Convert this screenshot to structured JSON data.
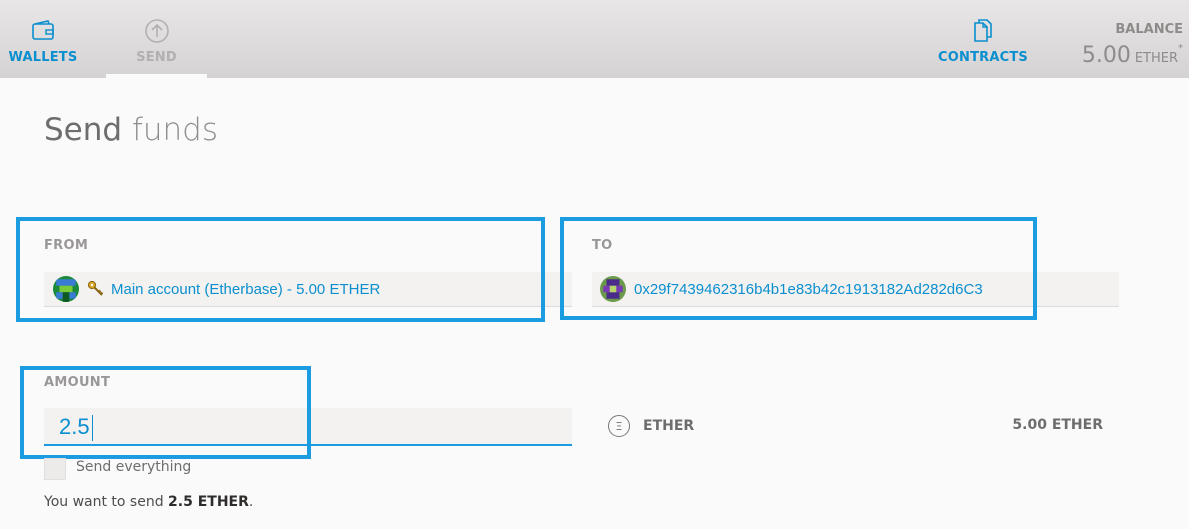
{
  "header": {
    "nav": {
      "wallets": {
        "label": "WALLETS",
        "icon": "wallet-icon"
      },
      "send": {
        "label": "SEND",
        "icon": "arrow-up-circle-icon"
      },
      "contracts": {
        "label": "CONTRACTS",
        "icon": "documents-icon"
      }
    },
    "balance": {
      "label": "BALANCE",
      "value": "5.00",
      "unit": "ETHER",
      "marker": "*"
    }
  },
  "page": {
    "title_word1": "Send",
    "title_word2": "funds"
  },
  "form": {
    "from": {
      "label": "FROM",
      "value": "Main account (Etherbase) - 5.00 ETHER",
      "key_icon": "key-icon"
    },
    "to": {
      "label": "TO",
      "value": "0x29f7439462316b4b1e83b42c1913182Ad282d6C3"
    },
    "amount": {
      "label": "AMOUNT",
      "value": "2.5",
      "unit": "ETHER",
      "unit_icon": "ether-symbol-icon",
      "available_balance": "5.00 ETHER"
    },
    "send_everything": {
      "label": "Send everything",
      "checked": false
    },
    "summary": {
      "prefix": "You want to send ",
      "amount": "2.5 ETHER",
      "suffix": "."
    }
  },
  "colors": {
    "accent": "#0b8fcf",
    "highlight_border": "#1b9be0",
    "header_bg": "#dcdada",
    "muted_text": "#9a9797"
  }
}
